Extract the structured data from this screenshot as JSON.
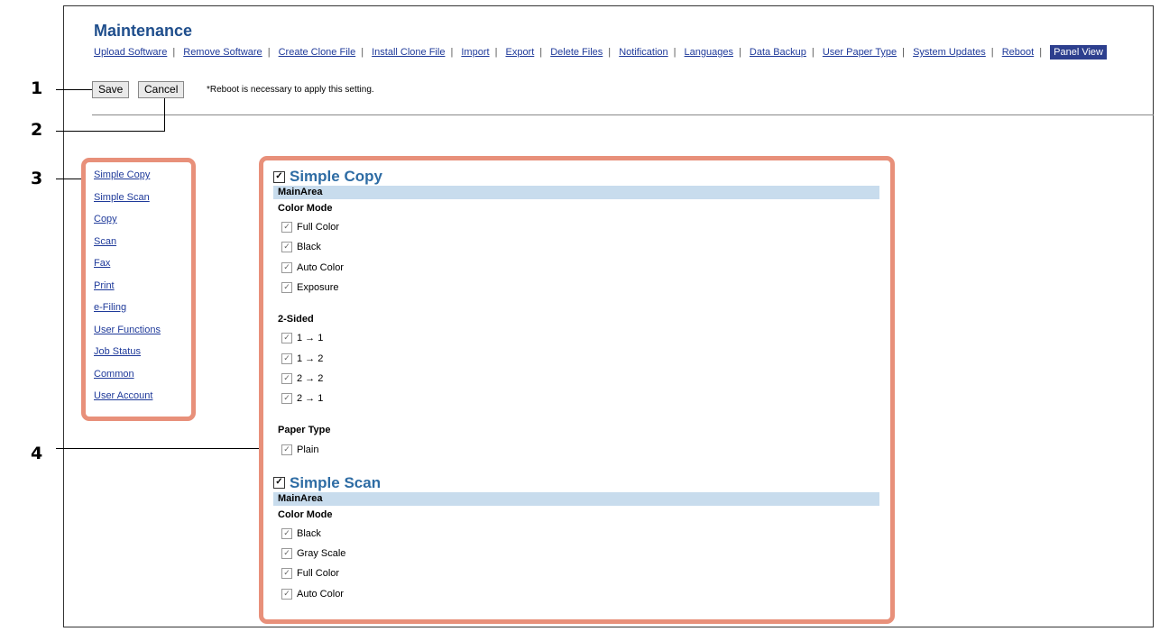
{
  "header": {
    "title": "Maintenance",
    "nav": [
      "Upload Software",
      "Remove Software",
      "Create Clone File",
      "Install Clone File",
      "Import",
      "Export",
      "Delete Files",
      "Notification",
      "Languages",
      "Data Backup",
      "User Paper Type",
      "System Updates",
      "Reboot"
    ],
    "active_tab": "Panel View"
  },
  "toolbar": {
    "save_label": "Save",
    "cancel_label": "Cancel",
    "note": "*Reboot is necessary to apply this setting."
  },
  "callouts": [
    "1",
    "2",
    "3",
    "4"
  ],
  "leftnav": [
    "Simple Copy",
    "Simple Scan",
    "Copy",
    "Scan",
    "Fax",
    "Print",
    "e-Filing",
    "User Functions",
    "Job Status",
    "Common",
    "User Account"
  ],
  "sections": [
    {
      "title": "Simple Copy",
      "area": "MainArea",
      "groups": [
        {
          "label": "Color Mode",
          "items": [
            "Full Color",
            "Black",
            "Auto Color",
            "Exposure"
          ]
        },
        {
          "label": "2-Sided",
          "items": [
            "1 → 1",
            "1 → 2",
            "2 → 2",
            "2 → 1"
          ]
        },
        {
          "label": "Paper Type",
          "items": [
            "Plain"
          ]
        }
      ]
    },
    {
      "title": "Simple Scan",
      "area": "MainArea",
      "groups": [
        {
          "label": "Color Mode",
          "items": [
            "Black",
            "Gray Scale",
            "Full Color",
            "Auto Color"
          ]
        }
      ]
    }
  ],
  "colors": {
    "accent": "#1f4e8c",
    "callout_box": "#e8907a",
    "area_bar": "#c8dced",
    "active_tab": "#2d3f8e"
  }
}
